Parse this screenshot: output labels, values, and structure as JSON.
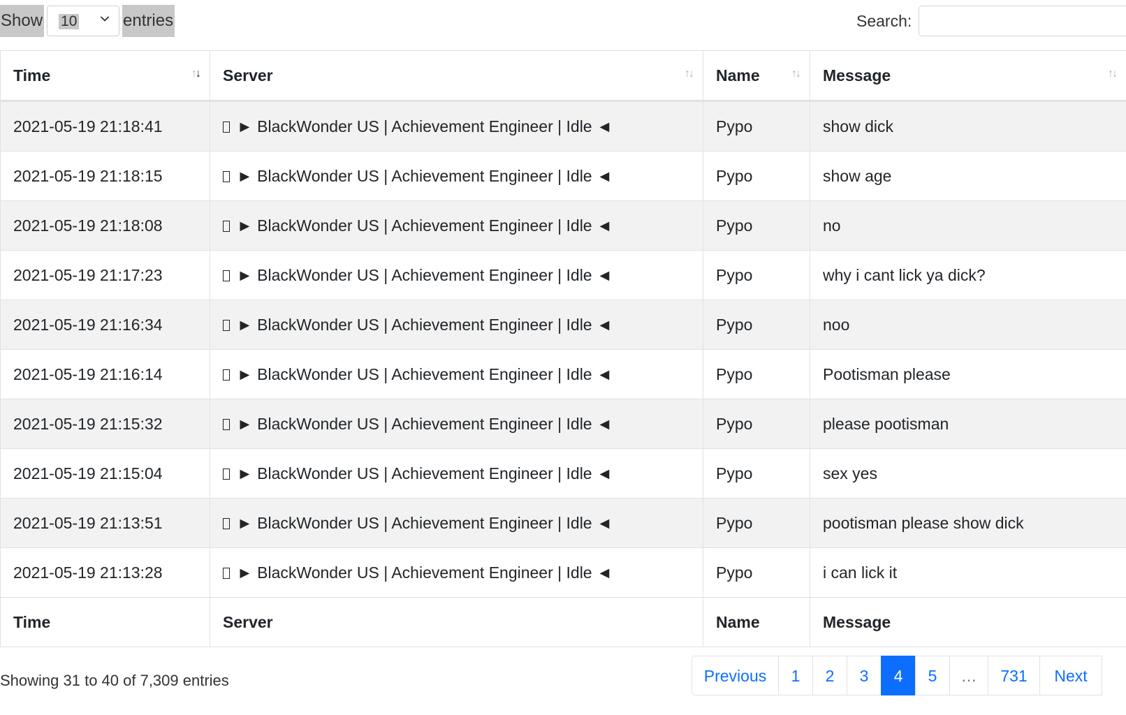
{
  "length_control": {
    "prefix": "Show",
    "value": "10",
    "suffix": "entries"
  },
  "search": {
    "label": "Search:",
    "value": "",
    "placeholder": ""
  },
  "table": {
    "columns": [
      "Time",
      "Server",
      "Name",
      "Message"
    ],
    "rows": [
      {
        "time": "2021-05-19 21:18:41",
        "server": "► BlackWonder US | Achievement Engineer | Idle ◄",
        "name": "Pypo",
        "message": "show dick"
      },
      {
        "time": "2021-05-19 21:18:15",
        "server": "► BlackWonder US | Achievement Engineer | Idle ◄",
        "name": "Pypo",
        "message": "show age"
      },
      {
        "time": "2021-05-19 21:18:08",
        "server": "► BlackWonder US | Achievement Engineer | Idle ◄",
        "name": "Pypo",
        "message": "no"
      },
      {
        "time": "2021-05-19 21:17:23",
        "server": "► BlackWonder US | Achievement Engineer | Idle ◄",
        "name": "Pypo",
        "message": "why i cant lick ya dick?"
      },
      {
        "time": "2021-05-19 21:16:34",
        "server": "► BlackWonder US | Achievement Engineer | Idle ◄",
        "name": "Pypo",
        "message": "noo"
      },
      {
        "time": "2021-05-19 21:16:14",
        "server": "► BlackWonder US | Achievement Engineer | Idle ◄",
        "name": "Pypo",
        "message": "Pootisman please"
      },
      {
        "time": "2021-05-19 21:15:32",
        "server": "► BlackWonder US | Achievement Engineer | Idle ◄",
        "name": "Pypo",
        "message": "please pootisman"
      },
      {
        "time": "2021-05-19 21:15:04",
        "server": "► BlackWonder US | Achievement Engineer | Idle ◄",
        "name": "Pypo",
        "message": "sex yes"
      },
      {
        "time": "2021-05-19 21:13:51",
        "server": "► BlackWonder US | Achievement Engineer | Idle ◄",
        "name": "Pypo",
        "message": "pootisman please show dick"
      },
      {
        "time": "2021-05-19 21:13:28",
        "server": "► BlackWonder US | Achievement Engineer | Idle ◄",
        "name": "Pypo",
        "message": "i can lick it"
      }
    ],
    "sort_icon": "↑↓",
    "server_glyph_icon": "missing-glyph-box"
  },
  "info": "Showing 31 to 40 of 7,309 entries",
  "pagination": {
    "previous": "Previous",
    "pages": [
      "1",
      "2",
      "3",
      "4",
      "5",
      "…",
      "731"
    ],
    "active_page": "4",
    "next": "Next"
  },
  "colors": {
    "accent": "#0d6efd",
    "stripe": "#f2f2f2",
    "border": "#dee2e6",
    "highlight": "#c8c8c8"
  }
}
